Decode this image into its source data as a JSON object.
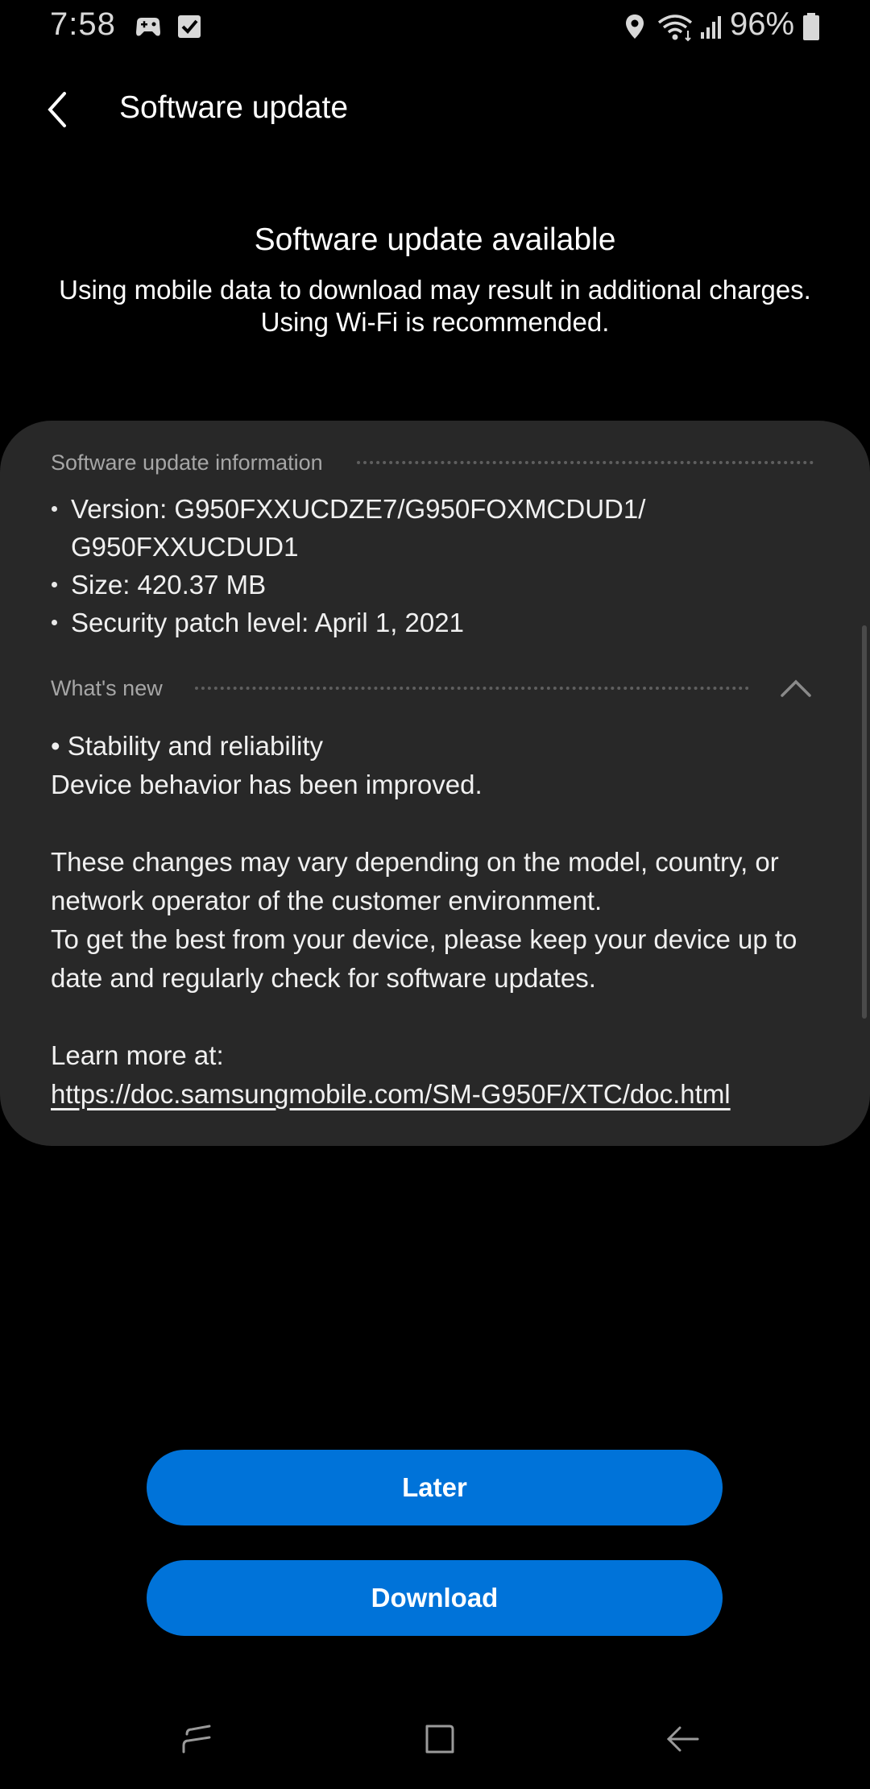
{
  "status_bar": {
    "time": "7:58",
    "battery": "96%",
    "icons": [
      "game-controller-icon",
      "checkbox-icon",
      "location-icon",
      "wifi-icon",
      "signal-icon",
      "battery-icon"
    ]
  },
  "header": {
    "title": "Software update",
    "back_icon": "chevron-left-icon"
  },
  "hero": {
    "title": "Software update available",
    "description": "Using mobile data to download may result in additional charges. Using Wi-Fi is recommended."
  },
  "info_section": {
    "label": "Software update information",
    "items": [
      "Version: G950FXXUCDZE7/G950FOXMCDUD1/ G950FXXUCDUD1",
      "Size: 420.37 MB",
      "Security patch level: April 1, 2021"
    ]
  },
  "whats_new": {
    "label": "What's new",
    "bullet": "• Stability and reliability",
    "line1": "Device behavior has been improved.",
    "para1": "These changes may vary depending on the model, country, or network operator of the customer environment.",
    "para2": "To get the best from your device, please keep your device up to date and regularly check for software updates.",
    "learn_more": "Learn more at:",
    "link": "https://doc.samsungmobile.com/SM-G950F/XTC/doc.html"
  },
  "buttons": {
    "later": "Later",
    "download": "Download"
  },
  "colors": {
    "background": "#000000",
    "card": "#282828",
    "accent": "#0073d9",
    "secondary_text": "#a6a6a6"
  },
  "nav_bar": {
    "icons": [
      "recents-icon",
      "home-icon",
      "back-icon"
    ]
  }
}
